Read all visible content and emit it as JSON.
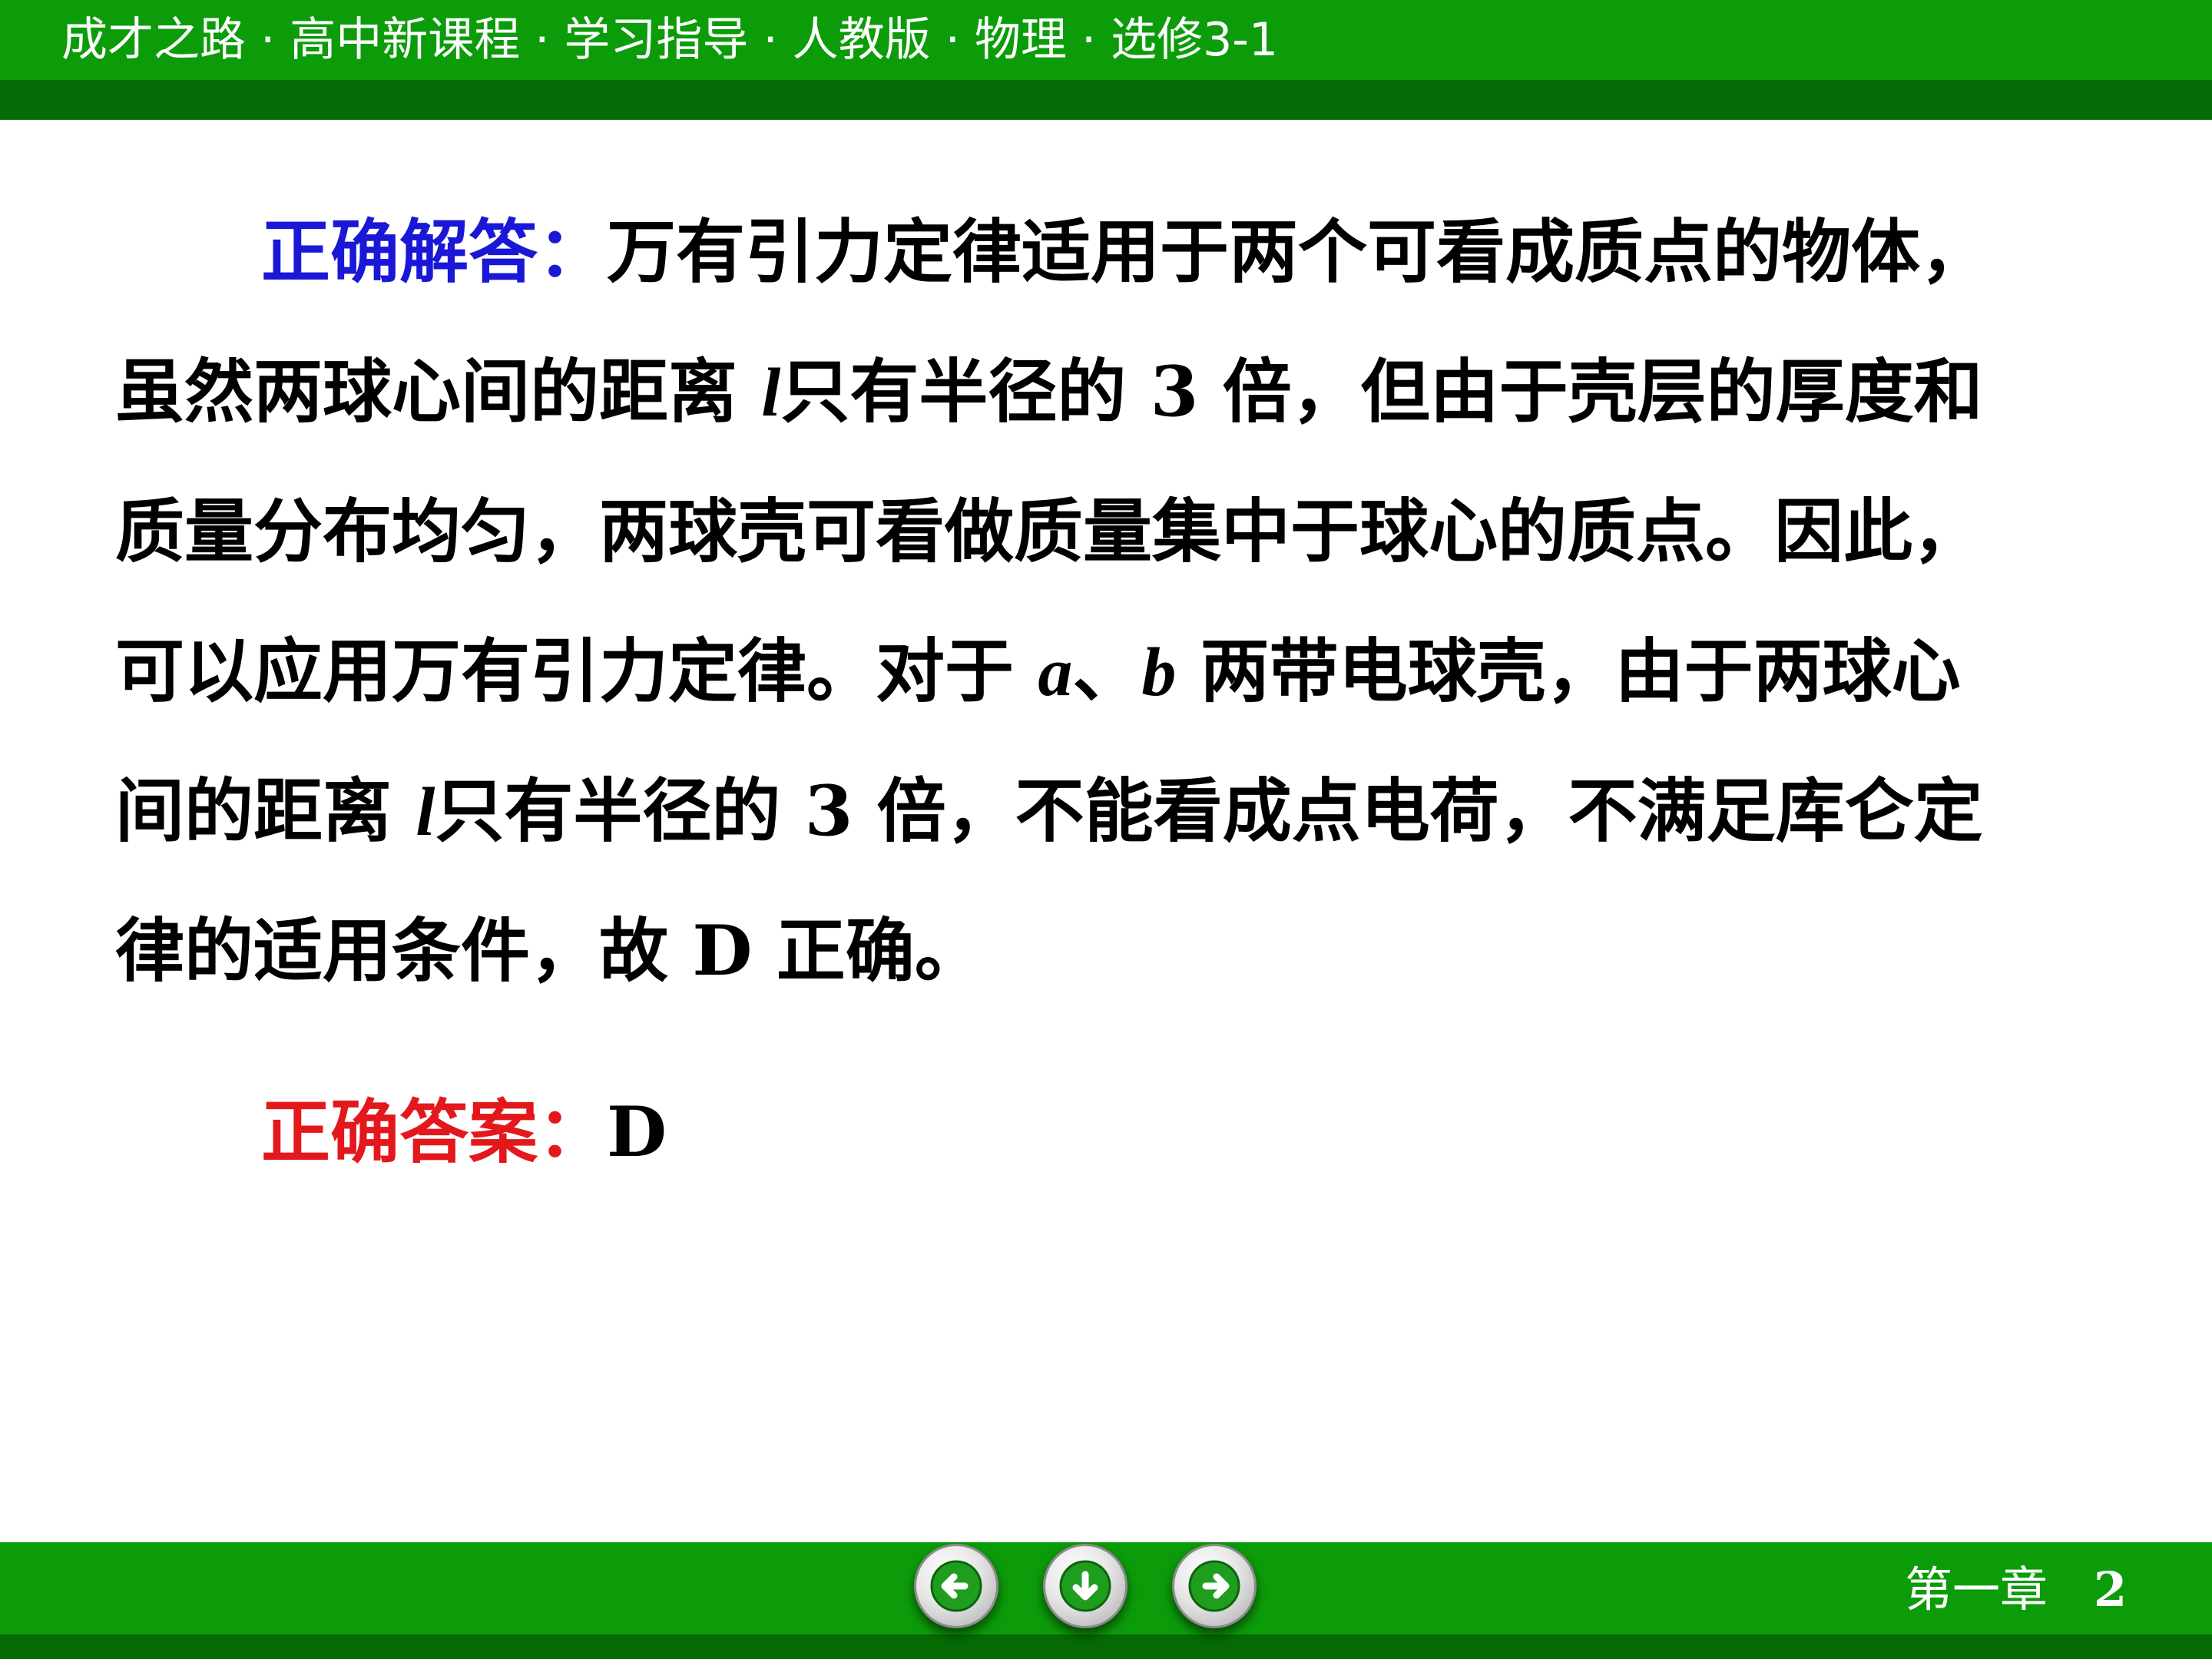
{
  "header": {
    "title": "成才之路 · 高中新课程  · 学习指导 · 人教版 · 物理 · 选修3-1"
  },
  "solution": {
    "label": "正确解答：",
    "line1": "万有引力定律适用于两个可看成质点的物体，",
    "line2_a": "虽然两球心间的距离 ",
    "var_l": "l",
    "line2_b": "只有半径的 3 倍，但由于壳层的厚度和",
    "line3": "质量分布均匀，两球壳可看做质量集中于球心的质点。因此，",
    "line4_a": "可以应用万有引力定律。对于 ",
    "var_a": "a",
    "line4_sep": "、",
    "var_b": "b",
    "line4_b": " 两带电球壳，由于两球心",
    "line5_a": "间的距离 ",
    "line5_b": "只有半径的 3 倍，不能看成点电荷，不满足库仑定",
    "line6": "律的适用条件，故 D 正确。"
  },
  "answer": {
    "label": "正确答案：",
    "value": "D"
  },
  "footer": {
    "chapter": "第一章",
    "page": "2"
  },
  "nav": {
    "prev_icon": "left-arrow-icon",
    "down_icon": "down-arrow-icon",
    "next_icon": "right-arrow-icon"
  },
  "colors": {
    "header_green": "#0c9c0a",
    "header_dark_green": "#056b05",
    "label_blue": "#1a17d6",
    "label_red": "#e3181c"
  }
}
